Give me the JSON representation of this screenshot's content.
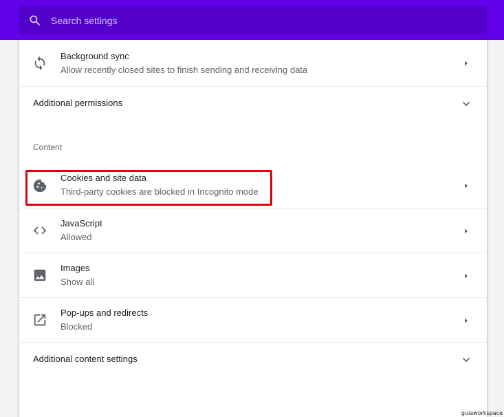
{
  "search": {
    "placeholder": "Search settings"
  },
  "rows": {
    "background_sync": {
      "title": "Background sync",
      "subtitle": "Allow recently closed sites to finish sending and receiving data"
    },
    "additional_permissions": {
      "title": "Additional permissions"
    },
    "content_section": {
      "label": "Content"
    },
    "cookies": {
      "title": "Cookies and site data",
      "subtitle": "Third-party cookies are blocked in Incognito mode"
    },
    "javascript": {
      "title": "JavaScript",
      "subtitle": "Allowed"
    },
    "images": {
      "title": "Images",
      "subtitle": "Show all"
    },
    "popups": {
      "title": "Pop-ups and redirects",
      "subtitle": "Blocked"
    },
    "additional_content": {
      "title": "Additional content settings"
    }
  },
  "watermark": "guiaworkspace",
  "icons": {
    "search": "search-icon",
    "sync": "sync-icon",
    "cookie": "cookie-icon",
    "code": "code-icon",
    "image": "image-icon",
    "popup": "open-in-new-icon",
    "arrow": "arrow-right-icon",
    "chevron": "chevron-down-icon"
  },
  "colors": {
    "header": "#6200ea",
    "search_box": "#5200c9",
    "highlight": "#e00010"
  }
}
